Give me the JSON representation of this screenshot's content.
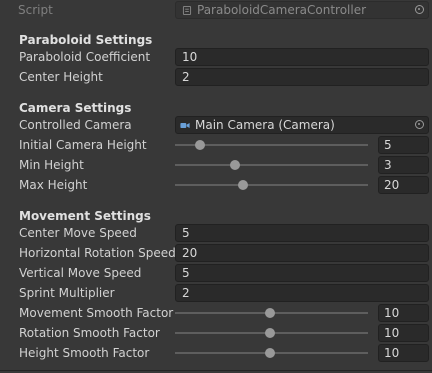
{
  "script_row": {
    "label": "Script",
    "value": "ParaboloidCameraController",
    "icon": "script-file-icon"
  },
  "paraboloid": {
    "header": "Paraboloid Settings",
    "coefficient": {
      "label": "Paraboloid Coefficient",
      "value": "10"
    },
    "center_height": {
      "label": "Center Height",
      "value": "2"
    }
  },
  "camera": {
    "header": "Camera Settings",
    "controlled_camera": {
      "label": "Controlled Camera",
      "value": "Main Camera (Camera)",
      "icon": "camera-icon"
    },
    "initial_height": {
      "label": "Initial Camera Height",
      "value": "5",
      "fraction": 0.13
    },
    "min_height": {
      "label": "Min Height",
      "value": "3",
      "fraction": 0.31
    },
    "max_height": {
      "label": "Max Height",
      "value": "20",
      "fraction": 0.35
    }
  },
  "movement": {
    "header": "Movement Settings",
    "center_move_speed": {
      "label": "Center Move Speed",
      "value": "5"
    },
    "horizontal_rotation_speed": {
      "label": "Horizontal Rotation Speed",
      "value": "20"
    },
    "vertical_move_speed": {
      "label": "Vertical Move Speed",
      "value": "5"
    },
    "sprint_multiplier": {
      "label": "Sprint Multiplier",
      "value": "2"
    },
    "movement_smooth": {
      "label": "Movement Smooth Factor",
      "value": "10",
      "fraction": 0.49
    },
    "rotation_smooth": {
      "label": "Rotation Smooth Factor",
      "value": "10",
      "fraction": 0.49
    },
    "height_smooth": {
      "label": "Height Smooth Factor",
      "value": "10",
      "fraction": 0.49
    }
  }
}
